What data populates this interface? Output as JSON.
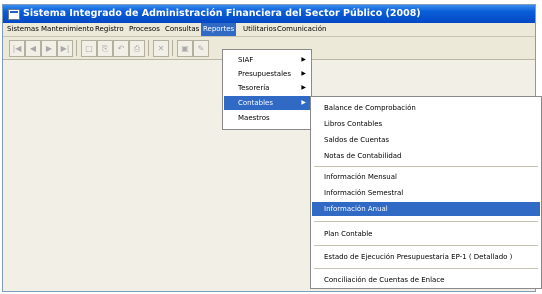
{
  "window": {
    "title": "Sistema Integrado de Administración Financiera del Sector Público (2008)"
  },
  "menubar": {
    "items": [
      "Sistemas",
      "Mantenimiento",
      "Registro",
      "Procesos",
      "Consultas",
      "Reportes",
      "Utilitarios",
      "Comunicación"
    ],
    "active": "Reportes"
  },
  "toolbar": {
    "buttons": [
      "first-icon",
      "previous-icon",
      "next-icon",
      "last-icon",
      "new-document-icon",
      "copy-icon",
      "undo-icon",
      "print-icon",
      "delete-icon",
      "save-icon",
      "edit-icon"
    ]
  },
  "reportes_menu": {
    "items": [
      "SIAF",
      "Presupuestales",
      "Tesorería",
      "Contables",
      "Maestros"
    ],
    "active": "Contables"
  },
  "contables_submenu": {
    "items": [
      "Balance de Comprobación",
      "Libros Contables",
      "Saldos de Cuentas",
      "Notas de Contabilidad",
      "Información Mensual",
      "Información Semestral",
      "Información Anual",
      "Plan Contable",
      "Estado de Ejecución Presupuestaria EP-1 ( Detallado )",
      "Conciliación de Cuentas de Enlace"
    ],
    "active": "Información Anual"
  },
  "colors": {
    "title_bar": "#0a5fd8",
    "highlight": "#316ac5",
    "menu_background": "#ece9d8"
  }
}
